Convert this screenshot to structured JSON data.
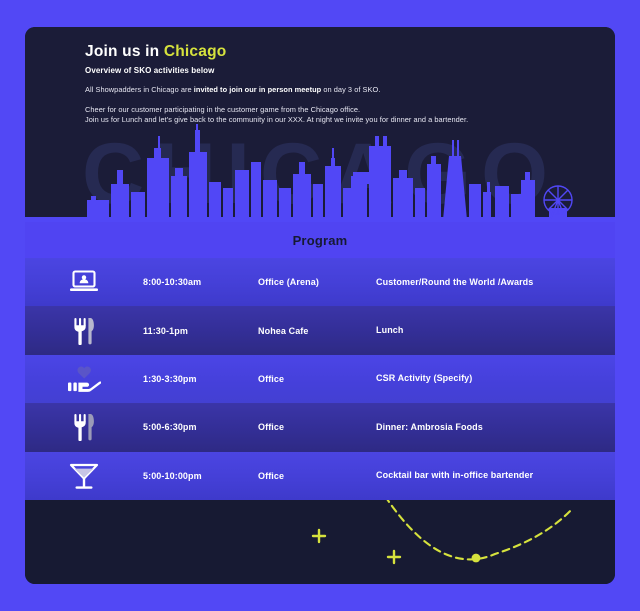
{
  "theme": {
    "page_bg": "#5248F5",
    "card_bg": "#171A33",
    "hero_bg": "#1B1C38",
    "accent_yellow": "#D6E23D",
    "program_band": "#5044F2",
    "row_light": "#4B45E2",
    "row_dark": "#332E96",
    "watermark": "#262A52",
    "skyline": "#5147F6"
  },
  "hero": {
    "title_prefix": "Join us in ",
    "title_accent": "Chicago",
    "subtitle": "Overview of SKO activities below",
    "paragraph1_part1": "All Showpadders in Chicago are ",
    "paragraph1_bold": "invited to join our in person meetup",
    "paragraph1_part2": " on day 3 of SKO.",
    "paragraph2_line1": "Cheer for our customer participating in the customer game from the Chicago office.",
    "paragraph2_line2": "Join us for Lunch and let's give back to the community in our XXX. At night we invite you for dinner and a bartender.",
    "watermark_text": "CHICAGO"
  },
  "program": {
    "header_label": "Program",
    "rows": [
      {
        "icon": "laptop-person-icon",
        "time": "8:00-10:30am",
        "place": "Office (Arena)",
        "description": "Customer/Round the World /Awards",
        "tone": "light"
      },
      {
        "icon": "fork-knife-icon",
        "time": "11:30-1pm",
        "place": "Nohea Cafe",
        "description": "Lunch",
        "tone": "dark"
      },
      {
        "icon": "hand-heart-icon",
        "time": "1:30-3:30pm",
        "place": "Office",
        "description": "CSR Activity (Specify)",
        "tone": "light"
      },
      {
        "icon": "fork-knife-icon",
        "time": "5:00-6:30pm",
        "place": "Office",
        "description": "Dinner: Ambrosia Foods",
        "tone": "dark"
      },
      {
        "icon": "martini-glass-icon",
        "time": "5:00-10:00pm",
        "place": "Office",
        "description": "Cocktail bar with in-office bartender",
        "tone": "light"
      }
    ]
  },
  "chart_data": {
    "type": "line",
    "title": "",
    "xlabel": "",
    "ylabel": "",
    "grid": true,
    "legend": false,
    "curve_color": "#D6E23D",
    "grid_color": "#3A3FA8",
    "series": [
      {
        "name": "parabola",
        "style": "dashed",
        "x": [
          0.6,
          0.66,
          0.72,
          0.78,
          0.84,
          0.9,
          0.96
        ],
        "y": [
          0.95,
          0.58,
          0.32,
          0.21,
          0.28,
          0.52,
          0.88
        ]
      }
    ],
    "markers": [
      {
        "type": "plus",
        "x": 0.5,
        "y": 0.42
      },
      {
        "type": "plus",
        "x": 0.62,
        "y": 0.18
      },
      {
        "type": "dot",
        "x": 0.79,
        "y": 0.2
      }
    ],
    "xlim": [
      0,
      1
    ],
    "ylim": [
      0,
      1
    ]
  }
}
